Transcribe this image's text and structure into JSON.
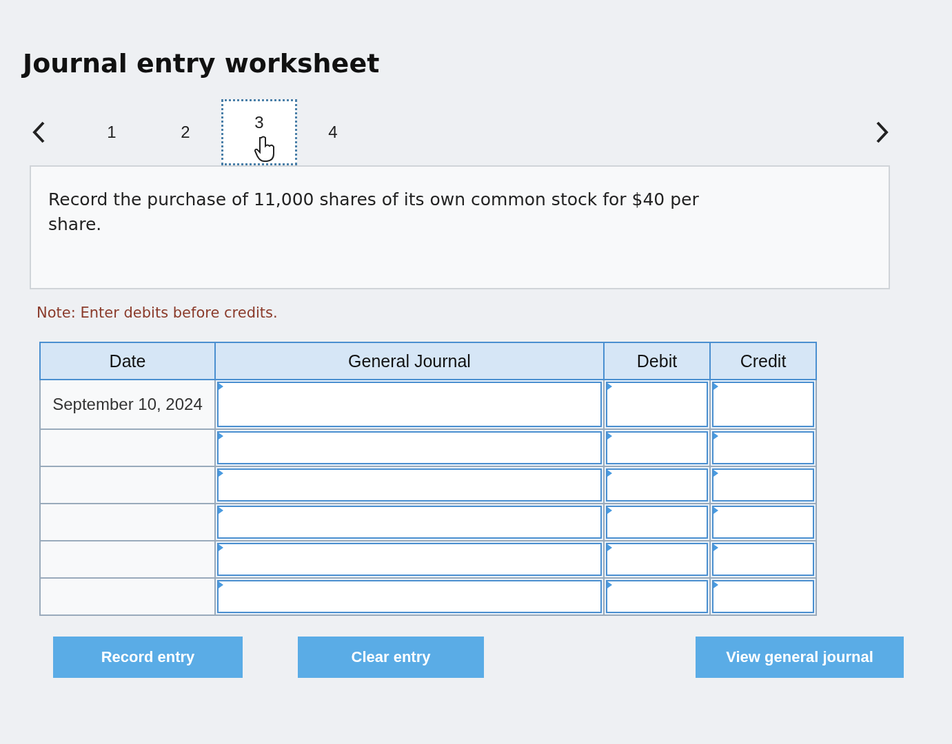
{
  "title": "Journal entry worksheet",
  "tabs": [
    {
      "label": "1",
      "selected": false
    },
    {
      "label": "2",
      "selected": false
    },
    {
      "label": "3",
      "selected": true
    },
    {
      "label": "4",
      "selected": false
    }
  ],
  "prompt": "Record the purchase of 11,000 shares of its own common stock for $40 per share.",
  "note": "Note: Enter debits before credits.",
  "table": {
    "columns": [
      "Date",
      "General Journal",
      "Debit",
      "Credit"
    ],
    "rows": [
      {
        "date": "September 10, 2024"
      },
      {},
      {},
      {},
      {},
      {}
    ]
  },
  "buttons": [
    "Record entry",
    "Clear entry",
    "View general journal"
  ]
}
